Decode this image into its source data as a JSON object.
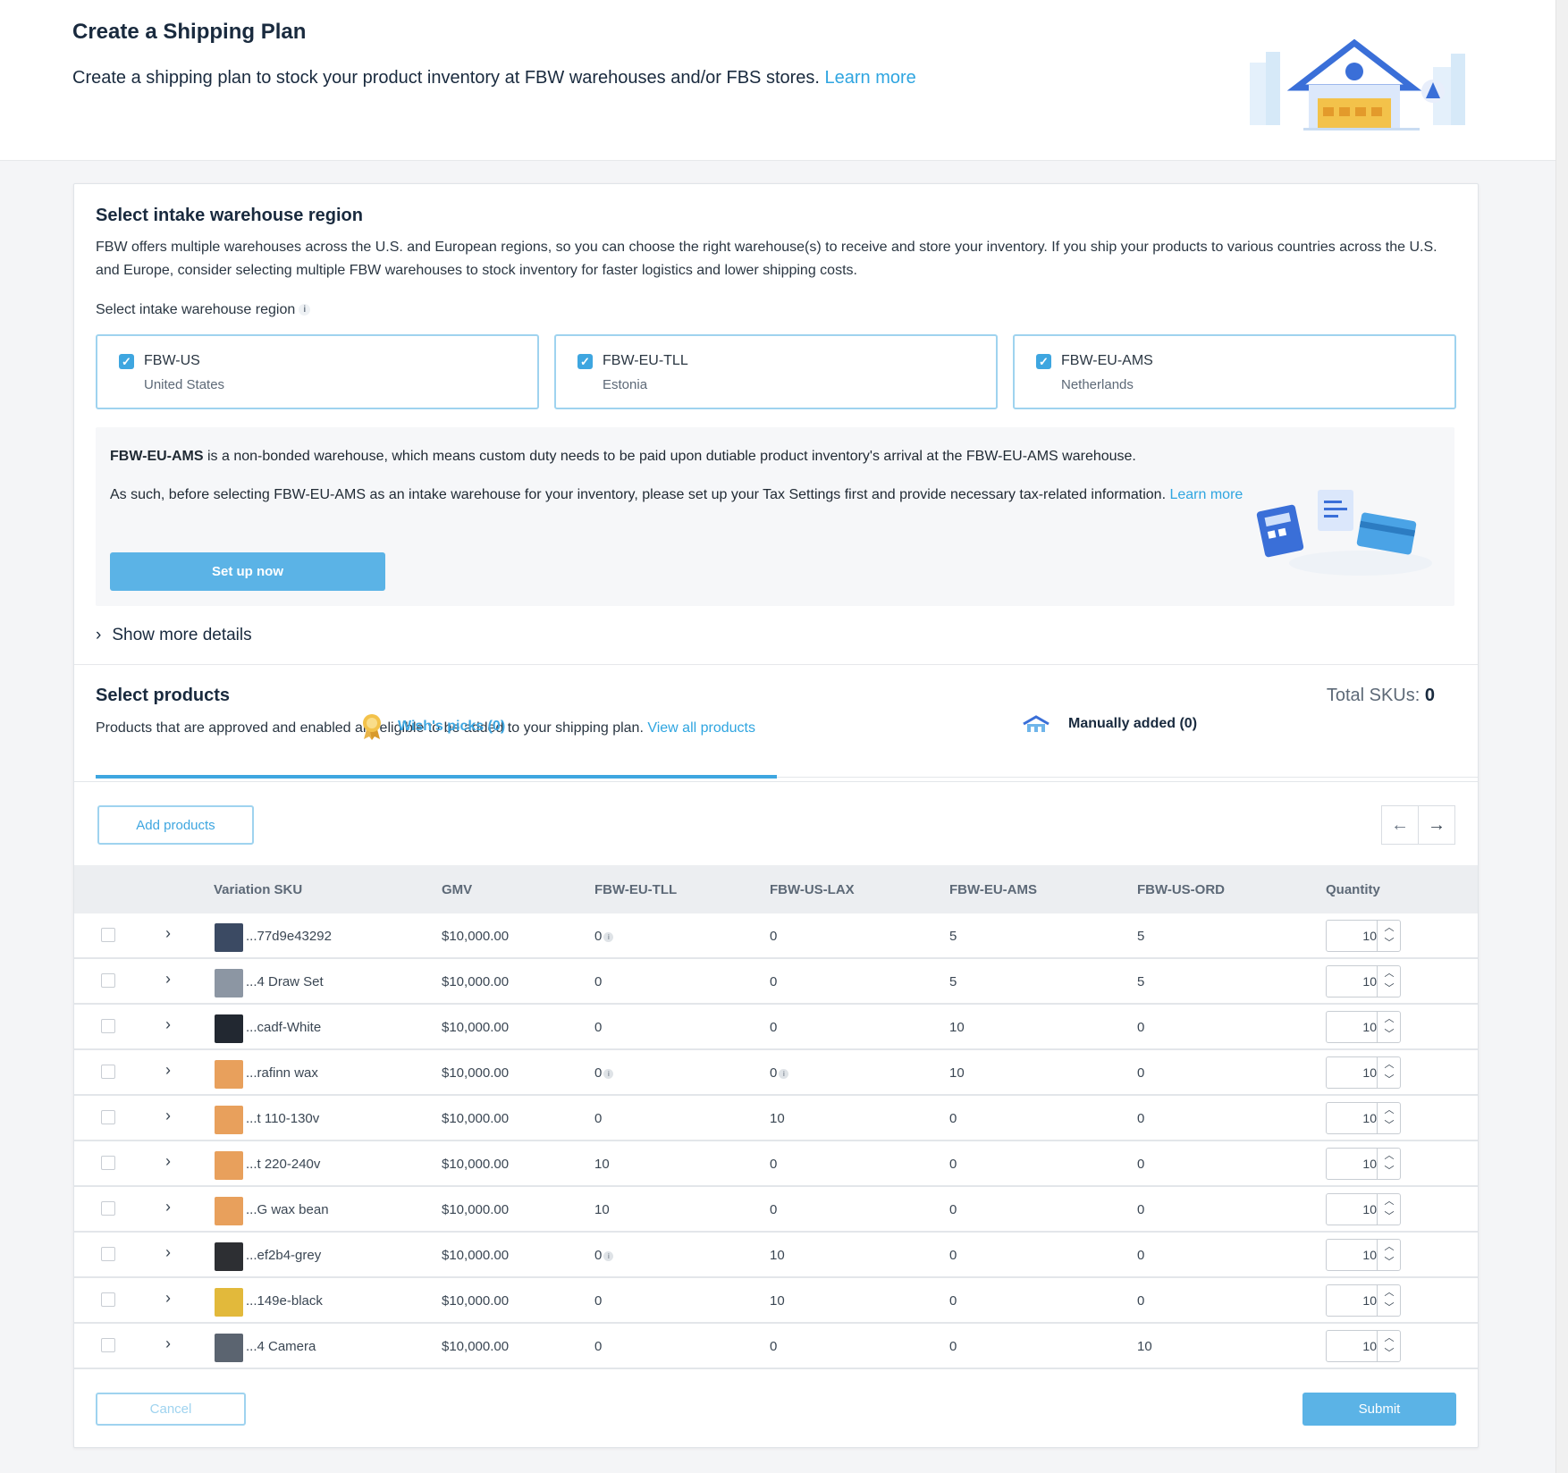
{
  "header": {
    "title": "Create a Shipping Plan",
    "subtitle": "Create a shipping plan to stock your product inventory at FBW warehouses and/or FBS stores.",
    "learn_more": "Learn more"
  },
  "region_section": {
    "title": "Select intake warehouse region",
    "description": "FBW offers multiple warehouses across the U.S. and European regions, so you can choose the right warehouse(s) to receive and store your inventory. If you ship your products to various countries across the U.S. and Europe, consider selecting multiple FBW warehouses to stock inventory for faster logistics and lower shipping costs.",
    "select_label": "Select intake warehouse region",
    "regions": [
      {
        "name": "FBW-US",
        "country": "United States",
        "checked": true
      },
      {
        "name": "FBW-EU-TLL",
        "country": "Estonia",
        "checked": true
      },
      {
        "name": "FBW-EU-AMS",
        "country": "Netherlands",
        "checked": true
      }
    ],
    "notice": {
      "bold": "FBW-EU-AMS",
      "line1_rest": " is a non-bonded warehouse, which means custom duty needs to be paid upon dutiable product inventory's arrival at the FBW-EU-AMS warehouse.",
      "line2": "As such, before selecting FBW-EU-AMS as an intake warehouse for your inventory, please set up your Tax Settings first and provide necessary tax-related information.",
      "learn_more": "Learn more",
      "button": "Set up now"
    },
    "show_more": "Show more details"
  },
  "products_section": {
    "title": "Select products",
    "total_skus_label": "Total SKUs:",
    "total_skus_value": "0",
    "description": "Products that are approved and enabled are eligible to be added to your shipping plan.",
    "view_all": "View all products",
    "tabs": [
      {
        "label": "Wish's picks (0)",
        "active": true,
        "icon": "award-medal-icon"
      },
      {
        "label": "Manually added (0)",
        "active": false,
        "icon": "truck-icon"
      }
    ],
    "add_products": "Add products",
    "colors": {
      "accent": "#3ea6e0",
      "button_primary": "#5bb3e6"
    }
  },
  "table": {
    "columns": [
      "Variation SKU",
      "GMV",
      "FBW-EU-TLL",
      "FBW-US-LAX",
      "FBW-EU-AMS",
      "FBW-US-ORD",
      "Quantity"
    ],
    "rows": [
      {
        "sku": "...77d9e43292",
        "gmv": "$10,000.00",
        "tll": "0",
        "tll_info": true,
        "lax": "0",
        "lax_info": false,
        "ams": "5",
        "ord": "5",
        "qty": "10",
        "thumb": "#3b4a63"
      },
      {
        "sku": "...4 Draw Set",
        "gmv": "$10,000.00",
        "tll": "0",
        "tll_info": false,
        "lax": "0",
        "lax_info": false,
        "ams": "5",
        "ord": "5",
        "qty": "10",
        "thumb": "#8c96a3"
      },
      {
        "sku": "...cadf-White",
        "gmv": "$10,000.00",
        "tll": "0",
        "tll_info": false,
        "lax": "0",
        "lax_info": false,
        "ams": "10",
        "ord": "0",
        "qty": "10",
        "thumb": "#222831"
      },
      {
        "sku": "...rafinn wax",
        "gmv": "$10,000.00",
        "tll": "0",
        "tll_info": true,
        "lax": "0",
        "lax_info": true,
        "ams": "10",
        "ord": "0",
        "qty": "10",
        "thumb": "#e8a05c"
      },
      {
        "sku": "...t 110-130v",
        "gmv": "$10,000.00",
        "tll": "0",
        "tll_info": false,
        "lax": "10",
        "lax_info": false,
        "ams": "0",
        "ord": "0",
        "qty": "10",
        "thumb": "#e8a05c"
      },
      {
        "sku": "...t 220-240v",
        "gmv": "$10,000.00",
        "tll": "10",
        "tll_info": false,
        "lax": "0",
        "lax_info": false,
        "ams": "0",
        "ord": "0",
        "qty": "10",
        "thumb": "#e8a05c"
      },
      {
        "sku": "...G wax bean",
        "gmv": "$10,000.00",
        "tll": "10",
        "tll_info": false,
        "lax": "0",
        "lax_info": false,
        "ams": "0",
        "ord": "0",
        "qty": "10",
        "thumb": "#e8a05c"
      },
      {
        "sku": "...ef2b4-grey",
        "gmv": "$10,000.00",
        "tll": "0",
        "tll_info": true,
        "lax": "10",
        "lax_info": false,
        "ams": "0",
        "ord": "0",
        "qty": "10",
        "thumb": "#2d2f33"
      },
      {
        "sku": "...149e-black",
        "gmv": "$10,000.00",
        "tll": "0",
        "tll_info": false,
        "lax": "10",
        "lax_info": false,
        "ams": "0",
        "ord": "0",
        "qty": "10",
        "thumb": "#e2b93b"
      },
      {
        "sku": "...4 Camera",
        "gmv": "$10,000.00",
        "tll": "0",
        "tll_info": false,
        "lax": "0",
        "lax_info": false,
        "ams": "0",
        "ord": "10",
        "qty": "10",
        "thumb": "#5b6470"
      }
    ]
  },
  "footer": {
    "cancel": "Cancel",
    "submit": "Submit"
  }
}
